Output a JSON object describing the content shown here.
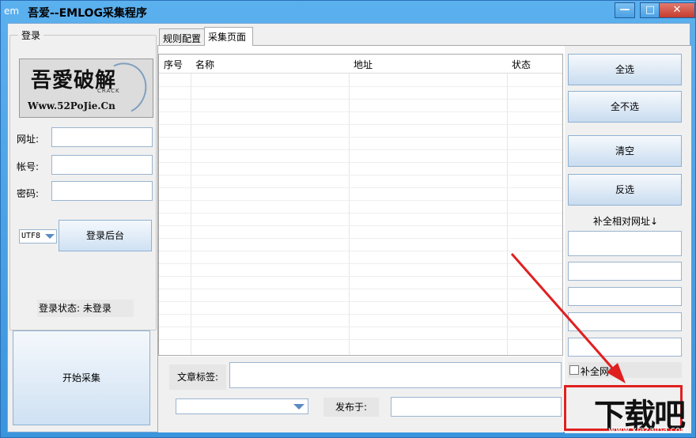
{
  "window": {
    "icon_text": "em",
    "title": "吾爱--EMLOG采集程序",
    "min_label": "—",
    "max_label": "□",
    "close_label": "✕"
  },
  "login": {
    "group_title": "登录",
    "logo": {
      "main": "吾愛破解",
      "url": "Www.52PoJie.Cn",
      "crack": "CRACK"
    },
    "url_label": "网址:",
    "url_value": "",
    "account_label": "帐号:",
    "account_value": "",
    "password_label": "密码:",
    "password_value": "",
    "encoding_selected": "UTF8",
    "login_button": "登录后台",
    "status_text": "登录状态: 未登录"
  },
  "start_button": "开始采集",
  "tabs": [
    {
      "label": "规则配置",
      "active": false
    },
    {
      "label": "采集页面",
      "active": true
    }
  ],
  "grid": {
    "columns": [
      "序号",
      "名称",
      "地址",
      "状态"
    ],
    "rows": []
  },
  "bottom": {
    "tag_label": "文章标签:",
    "tag_value": "",
    "category_selected": "",
    "publish_label": "发布于:",
    "publish_value": ""
  },
  "right": {
    "select_all": "全选",
    "select_none": "全不选",
    "clear": "清空",
    "invert": "反选",
    "fill_relative_label": "补全相对网址↓",
    "fill_inputs": [
      "",
      "",
      "",
      "",
      "",
      ""
    ],
    "fill_checkbox_label": "补全网址",
    "fill_checked": false
  },
  "watermark": {
    "main": "下载吧",
    "site": "www.xiazaiba.com"
  },
  "colors": {
    "annotation_red": "#e02020",
    "title_blue": "#3a95dd",
    "button_border": "#8fb1d3"
  }
}
